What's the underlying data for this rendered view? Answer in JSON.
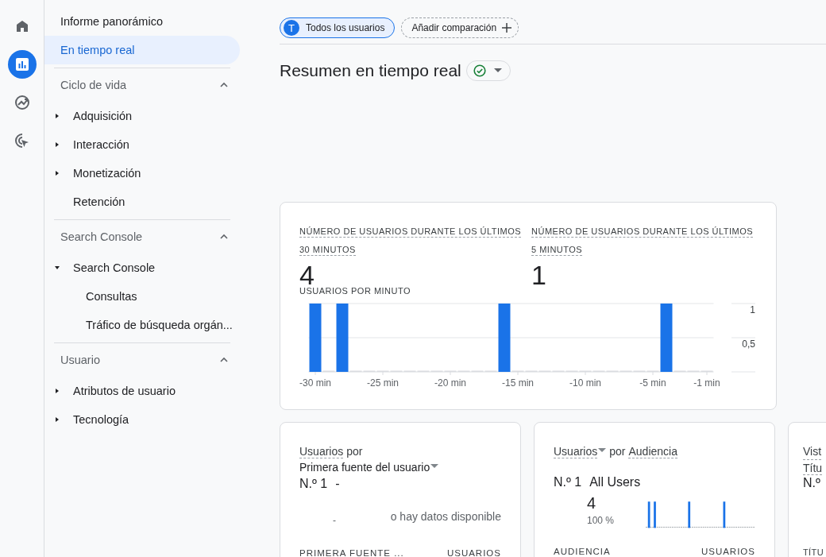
{
  "rail": {
    "items": [
      {
        "kind": "home",
        "selected": false
      },
      {
        "kind": "reports",
        "selected": true
      },
      {
        "kind": "explore",
        "selected": false
      },
      {
        "kind": "advertising",
        "selected": false
      }
    ]
  },
  "sidebar": {
    "items": [
      {
        "label": "Informe panorámico",
        "selected": false
      },
      {
        "label": "En tiempo real",
        "selected": true
      }
    ],
    "sections": [
      {
        "title": "Ciclo de vida",
        "expanded": true,
        "items": [
          {
            "label": "Adquisición",
            "expanded": false
          },
          {
            "label": "Interacción",
            "expanded": false
          },
          {
            "label": "Monetización",
            "expanded": false
          },
          {
            "label": "Retención"
          }
        ]
      },
      {
        "title": "Search Console",
        "expanded": true,
        "items": [
          {
            "label": "Search Console",
            "expanded": true,
            "children": [
              {
                "label": "Consultas"
              },
              {
                "label": "Tráfico de búsqueda orgán..."
              }
            ]
          }
        ]
      },
      {
        "title": "Usuario",
        "expanded": true,
        "items": [
          {
            "label": "Atributos de usuario",
            "expanded": false
          },
          {
            "label": "Tecnología",
            "expanded": false
          }
        ]
      }
    ]
  },
  "comparisons": [
    {
      "kind": "segment",
      "avatar": "T",
      "label": "Todos los usuarios",
      "selected": true
    },
    {
      "kind": "add",
      "label": "Añadir comparación"
    }
  ],
  "page_title": "Resumen en tiempo real",
  "status": {
    "kind": "ok"
  },
  "realtime_card": {
    "metrics": [
      {
        "label": "NÚMERO DE USUARIOS DURANTE LOS ÚLTIMOS 30 MINUTOS",
        "value": "4"
      },
      {
        "label": "NÚMERO DE USUARIOS DURANTE LOS ÚLTIMOS 5 MINUTOS",
        "value": "1"
      }
    ],
    "chart_data": {
      "type": "bar",
      "title": "USUARIOS POR MINUTO",
      "x": [
        -30,
        -29,
        -28,
        -27,
        -26,
        -25,
        -24,
        -23,
        -22,
        -21,
        -20,
        -19,
        -18,
        -17,
        -16,
        -15,
        -14,
        -13,
        -12,
        -11,
        -10,
        -9,
        -8,
        -7,
        -6,
        -5,
        -4,
        -3,
        -2,
        -1
      ],
      "values": [
        1,
        0,
        1,
        0,
        0,
        0,
        0,
        0,
        0,
        0,
        0,
        0,
        0,
        0,
        1,
        0,
        0,
        0,
        0,
        0,
        0,
        0,
        0,
        0,
        0,
        0,
        1,
        0,
        0,
        0
      ],
      "xticks": [
        {
          "value": -30,
          "label": "-30 min"
        },
        {
          "value": -25,
          "label": "-25 min"
        },
        {
          "value": -20,
          "label": "-20 min"
        },
        {
          "value": -15,
          "label": "-15 min"
        },
        {
          "value": -10,
          "label": "-10 min"
        },
        {
          "value": -5,
          "label": "-5 min"
        },
        {
          "value": -1,
          "label": "-1 min"
        }
      ],
      "yticks": [
        {
          "value": 0.5,
          "label": "0,5"
        },
        {
          "value": 1,
          "label": "1"
        }
      ],
      "xlim": [
        -30.5,
        -0.5
      ],
      "ylim": [
        0,
        1
      ]
    }
  },
  "cards": [
    {
      "kind": "empty",
      "metric": "Usuarios",
      "metric_dropdown": false,
      "connector": "por",
      "dimension": "Primera fuente del usuario",
      "dimension_dropdown": true,
      "rank": "N.º 1",
      "top_value": "-",
      "empty_mark": "-",
      "empty_text": "o hay datos disponible",
      "columns": [
        "PRIMERA FUENTE ...",
        "USUARIOS"
      ]
    },
    {
      "kind": "audience",
      "metric": "Usuarios",
      "metric_dropdown": true,
      "connector": "por",
      "dimension": "Audiencia",
      "dimension_dropdown": false,
      "rank": "N.º 1",
      "top_value": "All Users",
      "count": "4",
      "share": "100 %",
      "columns": [
        "AUDIENCIA",
        "USUARIOS"
      ]
    },
    {
      "kind": "partial",
      "metric": "Vist",
      "dimension": "Títu",
      "rank": "N.º",
      "columns": [
        "TÍTU"
      ]
    }
  ]
}
